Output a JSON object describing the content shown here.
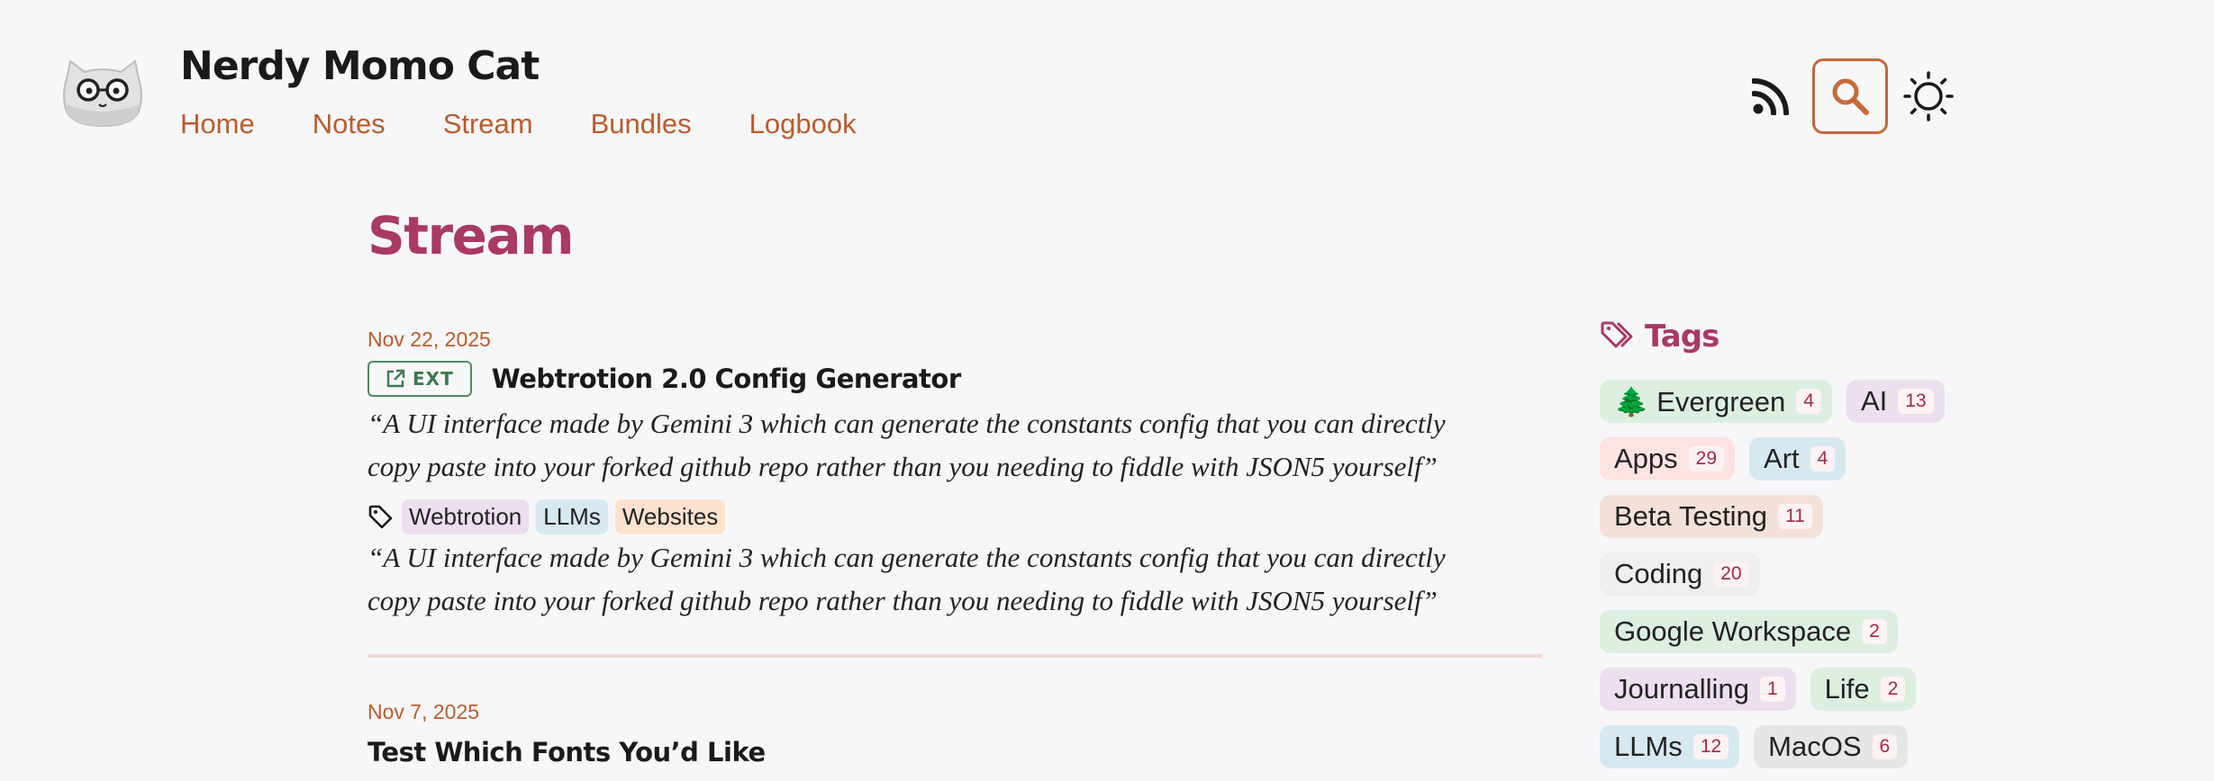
{
  "header": {
    "site_title": "Nerdy Momo Cat",
    "logo_icon": "cat-with-glasses-logo",
    "nav": [
      "Home",
      "Notes",
      "Stream",
      "Bundles",
      "Logbook"
    ],
    "icons": [
      "rss-icon",
      "search-icon",
      "sun-icon"
    ],
    "accent_color": "#c46a3a"
  },
  "main": {
    "title": "Stream",
    "title_color": "#a83a64",
    "posts": [
      {
        "date": "Nov 22, 2025",
        "badge": "EXT",
        "title": "Webtrotion 2.0 Config Generator",
        "quote_line1": "“A UI interface made by Gemini 3 which can generate the constants config that you can directly",
        "quote_line2": "copy paste into your forked github repo rather than you needing to fiddle with JSON5 yourself”",
        "tags": [
          "Webtrotion",
          "LLMs",
          "Websites"
        ],
        "quote2_line1": "“A UI interface made by Gemini 3 which can generate the constants config that you can directly",
        "quote2_line2": "copy paste into your forked github repo rather than you needing to fiddle with JSON5 yourself”"
      },
      {
        "date": "Nov 7, 2025",
        "title": "Test Which Fonts You’d Like"
      }
    ]
  },
  "sidebar": {
    "heading": "Tags",
    "tags": [
      {
        "label": "🌲 Evergreen",
        "count": "4",
        "color": "#dcefe0"
      },
      {
        "label": "AI",
        "count": "13",
        "color": "#ecdfee"
      },
      {
        "label": "Apps",
        "count": "29",
        "color": "#fde3e1"
      },
      {
        "label": "Art",
        "count": "4",
        "color": "#d7e9f0"
      },
      {
        "label": "Beta Testing",
        "count": "11",
        "color": "#f4e2da"
      },
      {
        "label": "Coding",
        "count": "20",
        "color": "#efeff1"
      },
      {
        "label": "Google Workspace",
        "count": "2",
        "color": "#dcefe0"
      },
      {
        "label": "Journalling",
        "count": "1",
        "color": "#ecdfee"
      },
      {
        "label": "Life",
        "count": "2",
        "color": "#dcefe0"
      },
      {
        "label": "LLMs",
        "count": "12",
        "color": "#d7e9f0"
      },
      {
        "label": "MacOS",
        "count": "6",
        "color": "#e6e6e8"
      }
    ]
  }
}
